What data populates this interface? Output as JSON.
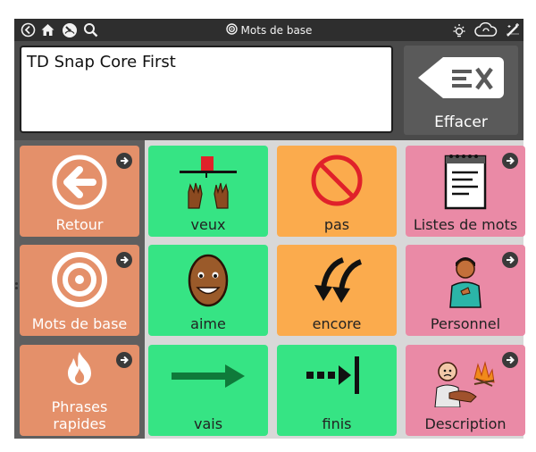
{
  "topbar": {
    "title": "Mots de base",
    "icons": [
      "back-circle-icon",
      "home-icon",
      "dashboard-icon",
      "search-icon",
      "brightness-icon",
      "cloud-sync-icon",
      "edit-wand-icon"
    ]
  },
  "message": {
    "text": "TD Snap Core First"
  },
  "clear_button": {
    "label": "Effacer"
  },
  "nav": [
    {
      "label": "Retour",
      "icon": "back-arrow-icon"
    },
    {
      "label": "Mots de base",
      "icon": "target-icon"
    },
    {
      "label": "Phrases rapides",
      "icon": "fire-icon"
    }
  ],
  "words": [
    {
      "label": "veux",
      "color": "#36e484"
    },
    {
      "label": "pas",
      "color": "#fbab4d"
    },
    {
      "label": "Listes de mots",
      "color": "#ea8aa6"
    },
    {
      "label": "aime",
      "color": "#36e484"
    },
    {
      "label": "encore",
      "color": "#fbab4d"
    },
    {
      "label": "Personnel",
      "color": "#ea8aa6"
    },
    {
      "label": "vais",
      "color": "#36e484"
    },
    {
      "label": "finis",
      "color": "#36e484"
    },
    {
      "label": "Description",
      "color": "#ea8aa6"
    }
  ]
}
